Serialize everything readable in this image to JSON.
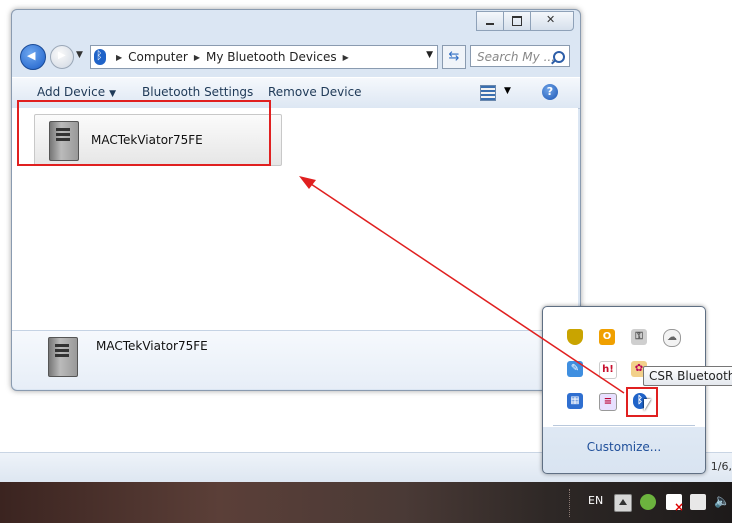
{
  "window": {
    "address": {
      "crumbs": [
        "Computer",
        "My Bluetooth Devices"
      ],
      "search_placeholder": "Search My ..."
    },
    "toolbar": {
      "add_device": "Add Device",
      "bluetooth_settings": "Bluetooth Settings",
      "remove_device": "Remove Device"
    },
    "device": {
      "name": "MACTekViator75FE"
    },
    "details": {
      "name": "MACTekViator75FE"
    }
  },
  "tray": {
    "tooltip": "CSR Bluetooth",
    "customize": "Customize..."
  },
  "taskbar": {
    "language": "EN",
    "date_fragment": "1/6,"
  },
  "annotation": {
    "color": "#e02020"
  }
}
